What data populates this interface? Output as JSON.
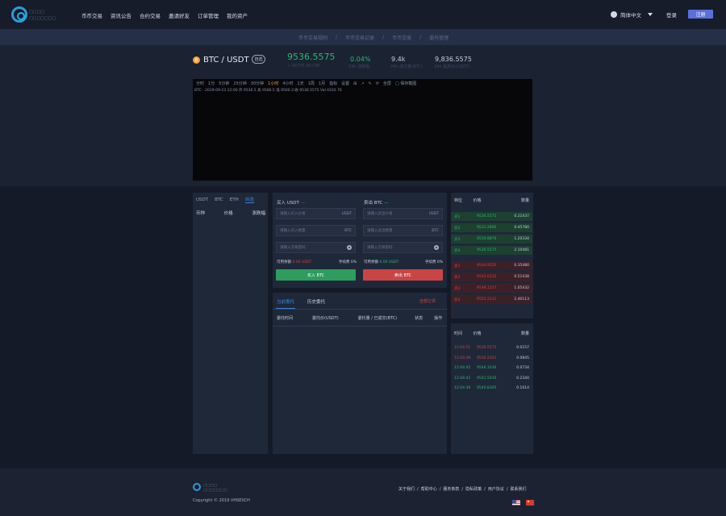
{
  "brand": {
    "line1": "□□□□",
    "line2": "□□□□□□□"
  },
  "nav": {
    "items": [
      "币币交易",
      "资讯公告",
      "合约交易",
      "邀请好友",
      "订单管理",
      "我的资产"
    ]
  },
  "header": {
    "language": "简体中文",
    "login": "登录",
    "register": "注册"
  },
  "breadcrumb": {
    "items": [
      "币币交易规则",
      "/",
      "币币交易记录",
      "/",
      "币币交易",
      "/",
      "委托管理"
    ]
  },
  "ticker": {
    "coin_glyph": "₿",
    "pair": "BTC / USDT",
    "badge": "自选",
    "last_price": "9536.5575",
    "last_price_sub": "≈ 66755.90 CNY",
    "change": "0.04%",
    "change_label": "24h 涨跌幅",
    "volume": "9.4k",
    "volume_label": "24h 成交量(BTC)",
    "high": "9,836.5575",
    "high_label": "24h 最高价(USDT)"
  },
  "chart": {
    "toolbar": [
      "分时",
      "1分",
      "5分钟",
      "15分钟",
      "30分钟",
      "1小时",
      "4小时",
      "1天",
      "1周",
      "1月",
      "指标",
      "设置",
      "⊞",
      "↗",
      "✎",
      "⟳",
      "全屏",
      "□ 保存截图"
    ],
    "ohlc_line": "BTC · 2019-09-23 12:00   开 9536.5   高 9586.5   低 9500.3   收 9536.5575   Vol 4102.76"
  },
  "colors": {
    "up": "#2eb673",
    "down": "#c84545",
    "accent": "#3d84d6",
    "brand_blue": "#5b6fd9"
  },
  "markets": {
    "tabs": [
      "USDT",
      "BTC",
      "ETH",
      "自选"
    ],
    "active_tab": 3,
    "headers": [
      "币种",
      "价格",
      "涨跌幅"
    ]
  },
  "buy_form": {
    "title": "买入 USDT",
    "price_ph": "请输入买入价格",
    "price_unit": "USDT",
    "qty_ph": "请输入买入数量",
    "qty_unit": "BTC",
    "pwd_ph": "请输入交易密码",
    "balance_label": "可用余额",
    "balance_value": "0.00 USDT",
    "fee": "手续费 0%",
    "button": "买入 BTC"
  },
  "sell_form": {
    "title": "卖出 BTC",
    "price_ph": "请输入卖出价格",
    "price_unit": "USDT",
    "qty_ph": "请输入卖出数量",
    "qty_unit": "BTC",
    "pwd_ph": "请输入交易密码",
    "balance_label": "可用余额",
    "balance_value": "0.00 USDT",
    "fee": "手续费 0%",
    "button": "卖出 BTC"
  },
  "orders": {
    "tabs": [
      "当前委托",
      "历史委托"
    ],
    "link": "全部订单",
    "headers": [
      "委托时间",
      "委托价(USDT)",
      "委托量 / 已成交(BTC)",
      "状态",
      "操作"
    ]
  },
  "orderbook": {
    "headers": [
      "档位",
      "价格",
      "数量"
    ],
    "bids": [
      {
        "label": "买1",
        "price": "9536.5575",
        "qty": "0.21437"
      },
      {
        "label": "买2",
        "price": "9531.2806",
        "qty": "0.45780"
      },
      {
        "label": "买3",
        "price": "9530.8876",
        "qty": "1.20334"
      },
      {
        "label": "买4",
        "price": "9536.5575",
        "qty": "2.10481"
      }
    ],
    "asks": [
      {
        "label": "卖1",
        "price": "9540.9550",
        "qty": "0.35480"
      },
      {
        "label": "卖2",
        "price": "9542.0235",
        "qty": "0.51438"
      },
      {
        "label": "卖3",
        "price": "9548.1227",
        "qty": "1.05432"
      },
      {
        "label": "卖4",
        "price": "9552.3111",
        "qty": "2.40113"
      }
    ]
  },
  "trades": {
    "headers": [
      "时间",
      "价格",
      "数量"
    ],
    "rows": [
      {
        "time": "12:04:51",
        "price": "9536.5575",
        "qty": "0.0157",
        "side": "down"
      },
      {
        "time": "12:04:48",
        "price": "9536.2022",
        "qty": "0.0845",
        "side": "down"
      },
      {
        "time": "12:04:45",
        "price": "9546.1036",
        "qty": "0.0734",
        "side": "up"
      },
      {
        "time": "12:04:41",
        "price": "9541.5036",
        "qty": "0.2340",
        "side": "up"
      },
      {
        "time": "12:04:36",
        "price": "9540.8305",
        "qty": "0.1014",
        "side": "up"
      }
    ]
  },
  "footer": {
    "line1": "□□□□",
    "line2": "□□□□□□□",
    "copyright": "Copyright © 2019 VHSEXCH",
    "links": [
      "关于我们",
      "/",
      "帮助中心",
      "/",
      "服务条款",
      "/",
      "隐私政策",
      "/",
      "用户协议",
      "/",
      "联系我们"
    ]
  }
}
